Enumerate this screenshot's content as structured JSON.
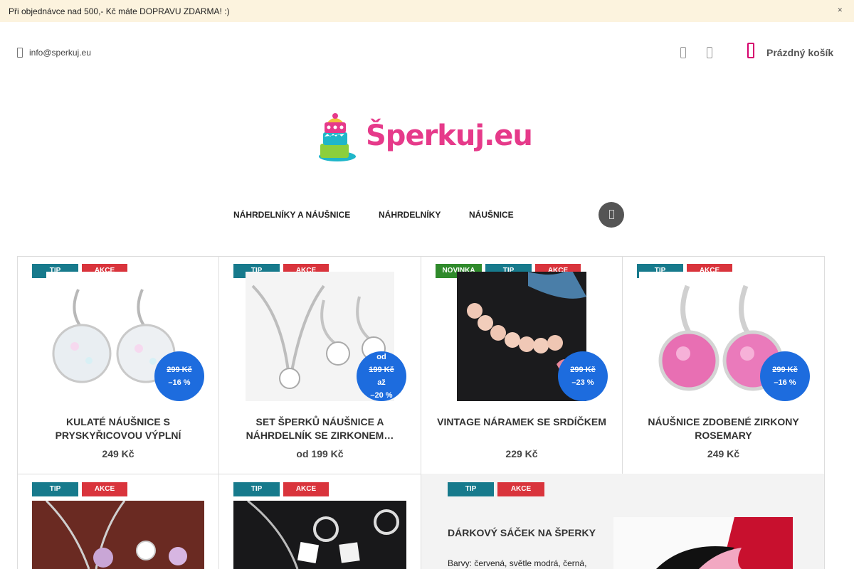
{
  "topbar": {
    "message": "Při objednávce nad 500,- Kč máte DOPRAVU ZDARMA! :)",
    "close_icon": "close-icon"
  },
  "header": {
    "email": "info@sperkuj.eu",
    "email_icon": "mail-icon",
    "icons": [
      "user-icon",
      "search-icon"
    ],
    "cart_label": "Prázdný košík",
    "cart_icon": "cart-icon",
    "accent": "#d6006e"
  },
  "logo": {
    "text": "Šperkuj.eu"
  },
  "nav": {
    "items": [
      "NÁHRDELNÍKY A NÁUŠNICE",
      "NÁHRDELNÍKY",
      "NÁUŠNICE"
    ],
    "search_icon": "search-icon"
  },
  "colors": {
    "tip": "#177a8c",
    "akce": "#d9343c",
    "novinka": "#2f8a2b",
    "discount_badge": "#1d6cde"
  },
  "products": [
    {
      "flags": [
        "TIP",
        "AKCE"
      ],
      "badge": {
        "prefix": "",
        "old_price": "299 Kč",
        "mid": "",
        "discount": "–16 %"
      },
      "name_line1": "KULATÉ NÁUŠNICE S",
      "name_line2": "PRYSKYŘICOVOU VÝPLNÍ",
      "price": "249 Kč"
    },
    {
      "flags": [
        "TIP",
        "AKCE"
      ],
      "badge": {
        "prefix": "od",
        "old_price": "199 Kč",
        "mid": "až",
        "discount": "–20 %"
      },
      "name_line1": "SET ŠPERKŮ NÁUŠNICE A",
      "name_line2": "NÁHRDELNÍK SE ZIRKONEM…",
      "price": "od 199 Kč"
    },
    {
      "flags": [
        "NOVINKA",
        "TIP",
        "AKCE"
      ],
      "badge": {
        "prefix": "",
        "old_price": "299 Kč",
        "mid": "",
        "discount": "–23 %"
      },
      "name_line1": "VINTAGE NÁRAMEK SE SRDÍČKEM",
      "name_line2": "",
      "price": "229 Kč"
    },
    {
      "flags": [
        "TIP",
        "AKCE"
      ],
      "badge": {
        "prefix": "",
        "old_price": "299 Kč",
        "mid": "",
        "discount": "–16 %"
      },
      "name_line1": "NÁUŠNICE ZDOBENÉ ZIRKONY",
      "name_line2": "ROSEMARY",
      "price": "249 Kč"
    },
    {
      "flags": [
        "TIP",
        "AKCE"
      ]
    },
    {
      "flags": [
        "TIP",
        "AKCE"
      ]
    }
  ],
  "featured": {
    "flags": [
      "TIP",
      "AKCE"
    ],
    "title": "DÁRKOVÝ SÁČEK NA ŠPERKY",
    "description": "Barvy: červená, světle modrá, černá,"
  }
}
